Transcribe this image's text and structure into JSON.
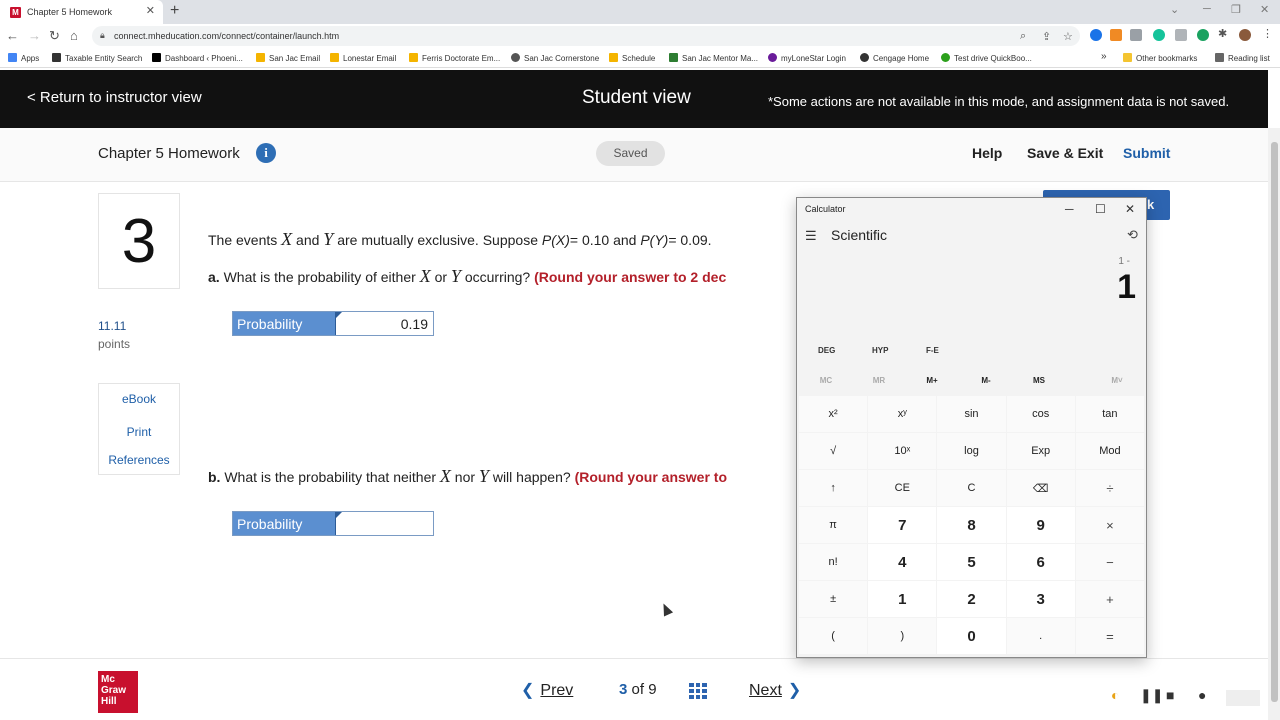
{
  "browser": {
    "tab_title": "Chapter 5 Homework",
    "favicon_letter": "M",
    "url": "connect.mheducation.com/connect/container/launch.htm",
    "bookmarks": [
      "Apps",
      "Taxable Entity Search",
      "Dashboard ‹ Phoeni...",
      "San Jac Email",
      "Lonestar Email",
      "Ferris Doctorate Em...",
      "San Jac Cornerstone",
      "Schedule",
      "San Jac Mentor Ma...",
      "myLoneStar Login",
      "Cengage Home",
      "Test drive QuickBoo..."
    ],
    "other_bookmarks": "Other bookmarks",
    "reading_list": "Reading list",
    "bookmark_overflow": "»"
  },
  "banner": {
    "back_label": "< Return to instructor view",
    "title": "Student view",
    "note": "*Some actions are not available in this mode, and assignment data is not saved."
  },
  "header": {
    "assignment_title": "Chapter 5 Homework",
    "info_icon": "i",
    "saved_label": "Saved",
    "help_label": "Help",
    "save_exit_label": "Save & Exit",
    "submit_label": "Submit"
  },
  "question": {
    "number": "3",
    "points": "11.11",
    "points_label": "points",
    "links": [
      "eBook",
      "Print",
      "References"
    ],
    "stem_pre": "The events",
    "var_x": "X",
    "and": "and",
    "var_y": "Y",
    "stem_post": "are mutually exclusive. Suppose",
    "px_label": "P(X)",
    "px_value": "= 0.10 and",
    "py_label": "P(Y)",
    "py_value": "= 0.09.",
    "part_a_letter": "a.",
    "part_a_text": "What is the probability of either",
    "part_a_or": "or",
    "part_a_end": "occurring?",
    "part_a_round": "(Round your answer to 2 dec",
    "part_a_label": "Probability",
    "part_a_value": "0.19",
    "part_b_letter": "b.",
    "part_b_text": "What is the probability that neither",
    "part_b_nor": "nor",
    "part_b_end": "will happen?",
    "part_b_round": "(Round your answer to",
    "part_b_label": "Probability",
    "part_b_value": "",
    "ask_button_suffix": "k"
  },
  "footer": {
    "logo_text": "Mc Graw Hill",
    "prev_label": "Prev",
    "page_current": "3",
    "page_of": "of",
    "page_total": "9",
    "next_label": "Next"
  },
  "calculator": {
    "window_title": "Calculator",
    "mode": "Scientific",
    "expression": "1 -",
    "display": "1",
    "angle_row": [
      "DEG",
      "HYP",
      "F-E"
    ],
    "memory_row": [
      "MC",
      "MR",
      "M+",
      "M-",
      "MS",
      "M˅"
    ],
    "keys": [
      "x²",
      "xʸ",
      "sin",
      "cos",
      "tan",
      "√",
      "10ˣ",
      "log",
      "Exp",
      "Mod",
      "↑",
      "CE",
      "C",
      "⌫",
      "÷",
      "π",
      "7",
      "8",
      "9",
      "×",
      "n!",
      "4",
      "5",
      "6",
      "−",
      "±",
      "1",
      "2",
      "3",
      "+",
      "(",
      ")",
      "0",
      ".",
      "="
    ]
  }
}
